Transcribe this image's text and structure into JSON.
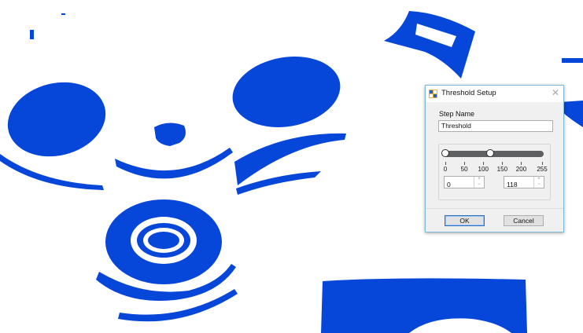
{
  "colors": {
    "blob": "#0646d8",
    "dialog_bg": "#f0f0f0",
    "accent_border": "#7fb7d6",
    "track": "#5f6062"
  },
  "dialog": {
    "title": "Threshold Setup",
    "close_icon": "close-icon",
    "app_icon": "threshold-app-icon",
    "step_name_label": "Step Name",
    "step_name_value": "Threshold",
    "slider": {
      "min": 0,
      "max": 255,
      "low_value": 0,
      "high_value": 118,
      "tick_labels": [
        "0",
        "50",
        "100",
        "150",
        "200",
        "255"
      ]
    },
    "low_input": "0",
    "high_input": "118",
    "ok_label": "OK",
    "cancel_label": "Cancel"
  }
}
